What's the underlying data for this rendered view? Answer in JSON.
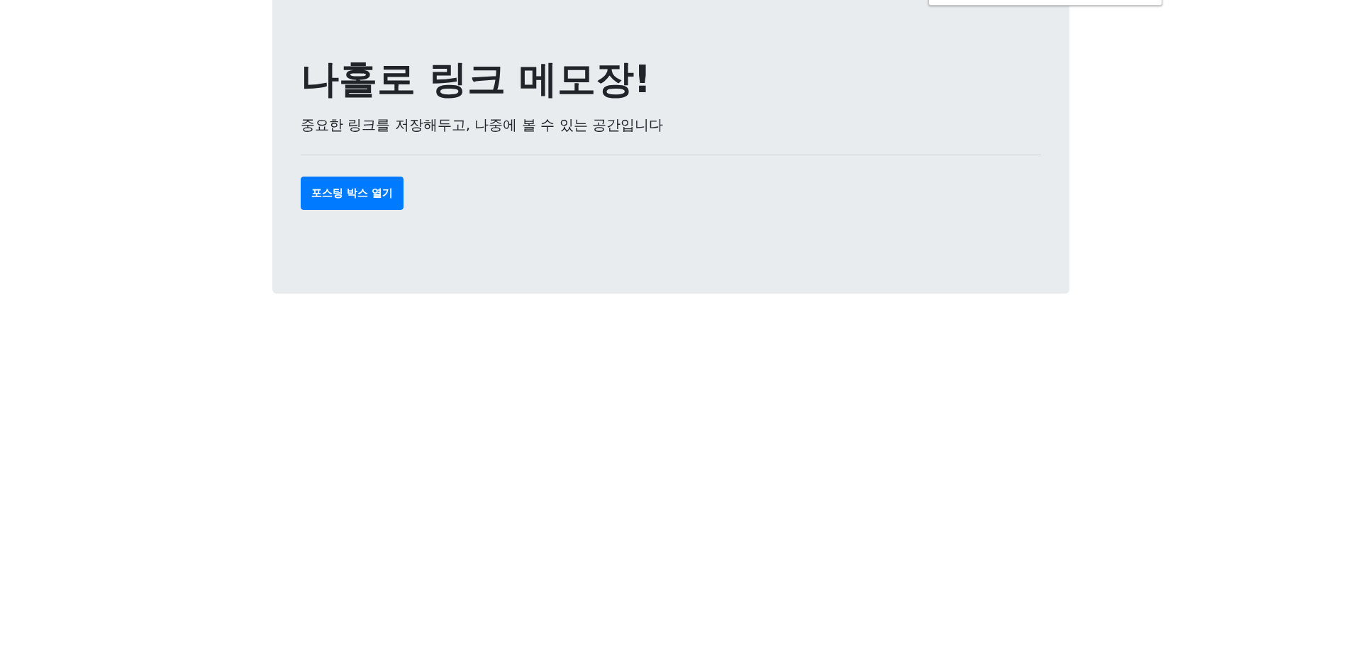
{
  "hero": {
    "title": "나홀로 링크 메모장!",
    "subtitle": "중요한 링크를 저장해두고, 나중에 볼 수 있는 공간입니다",
    "button": {
      "label": "포스팅 박스 열기"
    }
  }
}
